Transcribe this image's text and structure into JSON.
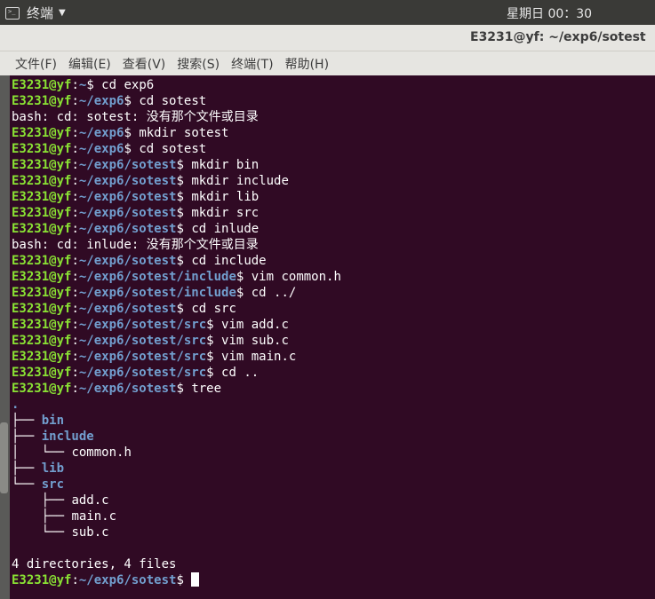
{
  "topbar": {
    "app_name": "终端",
    "clock": "星期日 00：30"
  },
  "window": {
    "title": "E3231@yf: ~/exp6/sotest"
  },
  "menu": [
    "文件(F)",
    "编辑(E)",
    "查看(V)",
    "搜索(S)",
    "终端(T)",
    "帮助(H)"
  ],
  "prompt_user": "E3231@yf",
  "lines": [
    {
      "type": "prompt",
      "path": "~",
      "cmd": " cd exp6"
    },
    {
      "type": "prompt",
      "path": "~/exp6",
      "cmd": " cd sotest"
    },
    {
      "type": "out",
      "text": "bash: cd: sotest: 没有那个文件或目录"
    },
    {
      "type": "prompt",
      "path": "~/exp6",
      "cmd": " mkdir sotest"
    },
    {
      "type": "prompt",
      "path": "~/exp6",
      "cmd": " cd sotest"
    },
    {
      "type": "prompt",
      "path": "~/exp6/sotest",
      "cmd": " mkdir bin"
    },
    {
      "type": "prompt",
      "path": "~/exp6/sotest",
      "cmd": " mkdir include"
    },
    {
      "type": "prompt",
      "path": "~/exp6/sotest",
      "cmd": " mkdir lib"
    },
    {
      "type": "prompt",
      "path": "~/exp6/sotest",
      "cmd": " mkdir src"
    },
    {
      "type": "prompt",
      "path": "~/exp6/sotest",
      "cmd": " cd inlude"
    },
    {
      "type": "out",
      "text": "bash: cd: inlude: 没有那个文件或目录"
    },
    {
      "type": "prompt",
      "path": "~/exp6/sotest",
      "cmd": " cd include"
    },
    {
      "type": "prompt",
      "path": "~/exp6/sotest/include",
      "cmd": " vim common.h"
    },
    {
      "type": "prompt",
      "path": "~/exp6/sotest/include",
      "cmd": " cd ../"
    },
    {
      "type": "prompt",
      "path": "~/exp6/sotest",
      "cmd": " cd src"
    },
    {
      "type": "prompt",
      "path": "~/exp6/sotest/src",
      "cmd": " vim add.c"
    },
    {
      "type": "prompt",
      "path": "~/exp6/sotest/src",
      "cmd": " vim sub.c"
    },
    {
      "type": "prompt",
      "path": "~/exp6/sotest/src",
      "cmd": " vim main.c"
    },
    {
      "type": "prompt",
      "path": "~/exp6/sotest/src",
      "cmd": " cd .."
    },
    {
      "type": "prompt",
      "path": "~/exp6/sotest",
      "cmd": " tree"
    },
    {
      "type": "tree",
      "prefix": "",
      "name": ".",
      "dir": true
    },
    {
      "type": "tree",
      "prefix": "├── ",
      "name": "bin",
      "dir": true
    },
    {
      "type": "tree",
      "prefix": "├── ",
      "name": "include",
      "dir": true
    },
    {
      "type": "tree",
      "prefix": "│   └── ",
      "name": "common.h",
      "dir": false
    },
    {
      "type": "tree",
      "prefix": "├── ",
      "name": "lib",
      "dir": true
    },
    {
      "type": "tree",
      "prefix": "└── ",
      "name": "src",
      "dir": true
    },
    {
      "type": "tree",
      "prefix": "    ├── ",
      "name": "add.c",
      "dir": false
    },
    {
      "type": "tree",
      "prefix": "    ├── ",
      "name": "main.c",
      "dir": false
    },
    {
      "type": "tree",
      "prefix": "    └── ",
      "name": "sub.c",
      "dir": false
    },
    {
      "type": "blank"
    },
    {
      "type": "out",
      "text": "4 directories, 4 files"
    },
    {
      "type": "prompt",
      "path": "~/exp6/sotest",
      "cmd": " ",
      "cursor": true
    }
  ],
  "colors": {
    "background": "#300a24",
    "user": "#8ae234",
    "path": "#729fcf",
    "text": "#ffffff"
  }
}
